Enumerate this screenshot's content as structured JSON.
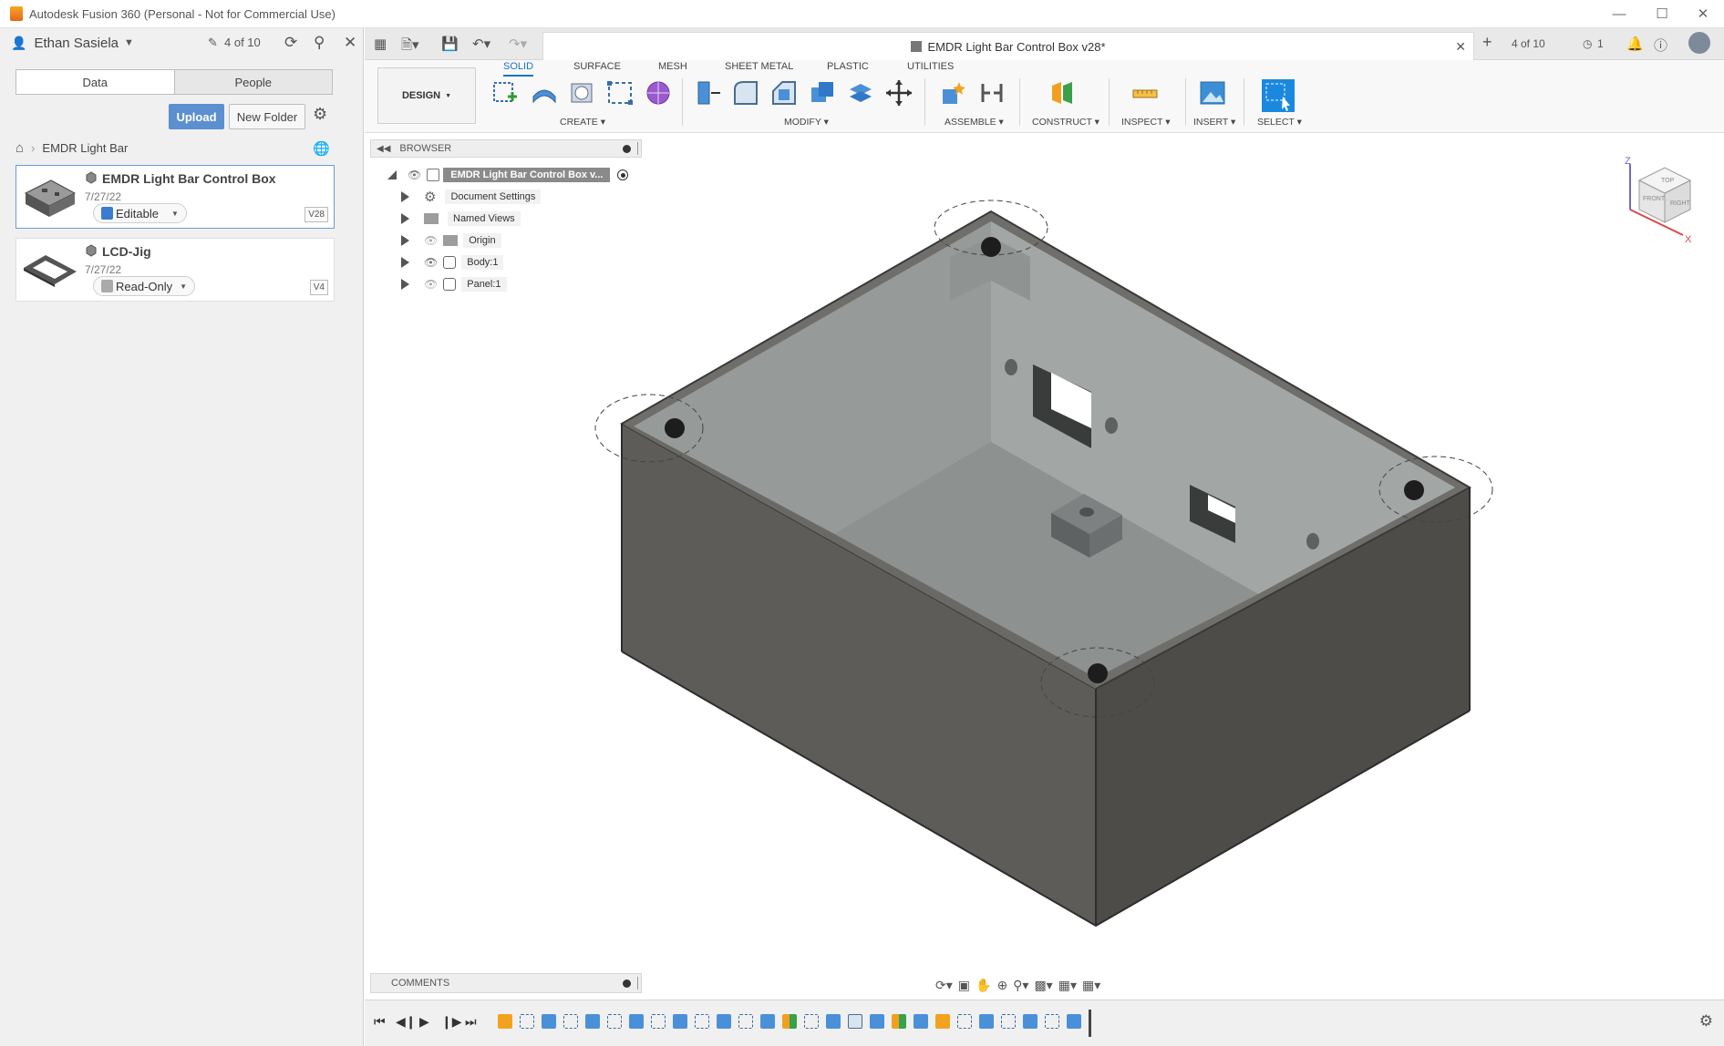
{
  "window": {
    "title": "Autodesk Fusion 360 (Personal - Not for Commercial Use)",
    "accent": "#e5661b"
  },
  "data_panel": {
    "user": "Ethan Sasiela",
    "doc_count": "4 of 10",
    "tabs": [
      "Data",
      "People"
    ],
    "upload_label": "Upload",
    "new_folder_label": "New Folder",
    "breadcrumb": "EMDR Light Bar",
    "files": [
      {
        "name": "EMDR Light Bar Control Box",
        "date": "7/27/22",
        "state": "Editable",
        "version": "V28"
      },
      {
        "name": "LCD-Jig",
        "date": "7/27/22",
        "state": "Read-Only",
        "version": "V4"
      }
    ]
  },
  "tabbar": {
    "doc_title": "EMDR Light Bar Control Box v28*",
    "doc_count": "4 of 10",
    "jobs_count": "1"
  },
  "ribbon": {
    "workspace": "DESIGN",
    "tabs": [
      "SOLID",
      "SURFACE",
      "MESH",
      "SHEET METAL",
      "PLASTIC",
      "UTILITIES"
    ],
    "groups": [
      "CREATE",
      "MODIFY",
      "ASSEMBLE",
      "CONSTRUCT",
      "INSPECT",
      "INSERT",
      "SELECT"
    ]
  },
  "browser": {
    "header": "BROWSER",
    "root": "EMDR Light Bar Control Box v...",
    "items": [
      "Document Settings",
      "Named Views",
      "Origin",
      "Body:1",
      "Panel:1"
    ]
  },
  "comments": {
    "header": "COMMENTS"
  },
  "viewcube": {
    "faces": [
      "TOP",
      "FRONT",
      "RIGHT"
    ],
    "axes": [
      "Z",
      "X"
    ]
  }
}
